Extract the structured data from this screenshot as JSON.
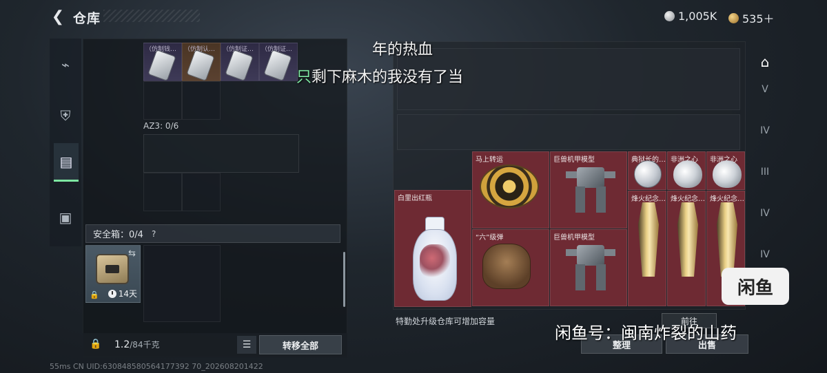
{
  "header": {
    "back_icon": "chevron-left-icon",
    "title": "仓库",
    "currency_silver": "1,005K",
    "currency_gold": "535＋"
  },
  "left_rail": [
    "gun-icon",
    "armor-icon",
    "backpack-icon",
    "kit-icon"
  ],
  "backpack": {
    "items": [
      {
        "name": "（仿制钱…",
        "style": "purple"
      },
      {
        "name": "（仿制认…",
        "style": "orange"
      },
      {
        "name": "（仿制证…",
        "style": "purple"
      },
      {
        "name": "（仿制证…",
        "style": "purple"
      }
    ],
    "az3_label": "AZ3: 0/6"
  },
  "safe_box": {
    "label": "安全箱：0/4",
    "help": "?",
    "days": "14天"
  },
  "bottom": {
    "weight_value": "1.2",
    "weight_max": "/84千克",
    "transfer_all": "转移全部"
  },
  "storage": {
    "items": {
      "vase": "白里出红瓶",
      "wheel": "马上转运",
      "mech1": "巨兽机甲模型",
      "orb": "典狱长的…",
      "heart1": "非洲之心",
      "heart2": "非洲之心",
      "hand": "“六”级弹",
      "mech2": "巨兽机甲模型",
      "trophy1": "烽火纪念…",
      "trophy2": "烽火纪念…",
      "trophy3": "烽火纪念…"
    },
    "footer_note": "特勤处升级仓库可增加容量",
    "goto": "前往",
    "sort": "整理",
    "sell": "出售"
  },
  "right_rail": [
    "storage-icon",
    "V",
    "IV",
    "III",
    "IV",
    "IV"
  ],
  "overlay": {
    "caption_line1": "年的热血",
    "caption_line2_green": "只",
    "caption_line2_rest": "剩下麻木的我没有了当",
    "watermark_badge": "闲鱼",
    "watermark_id": "闲鱼号：闽南炸裂的山药",
    "uid": "55ms  CN UID:630848580564177392 70_202608201422"
  }
}
